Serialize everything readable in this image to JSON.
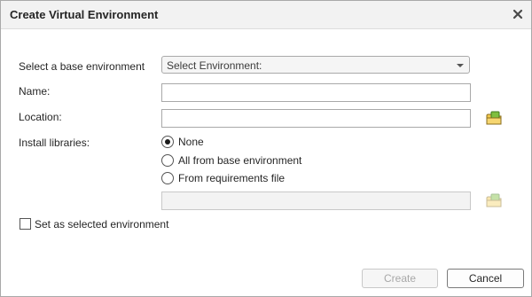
{
  "window": {
    "title": "Create Virtual Environment",
    "close_icon": "close-icon"
  },
  "form": {
    "base_env_label": "Select a base environment",
    "base_env_value": "Select Environment:",
    "name_label": "Name:",
    "name_value": "",
    "location_label": "Location:",
    "location_value": "",
    "install_label": "Install libraries:",
    "install_options": [
      {
        "label": "None",
        "selected": true
      },
      {
        "label": "All from base environment",
        "selected": false
      },
      {
        "label": "From requirements file",
        "selected": false
      }
    ],
    "requirements_value": "",
    "set_selected_label": "Set as selected environment",
    "set_selected_checked": false
  },
  "buttons": {
    "create_label": "Create",
    "cancel_label": "Cancel"
  },
  "colors": {
    "folder_green": "#7fbf3f",
    "folder_yellow": "#f2c94c"
  }
}
